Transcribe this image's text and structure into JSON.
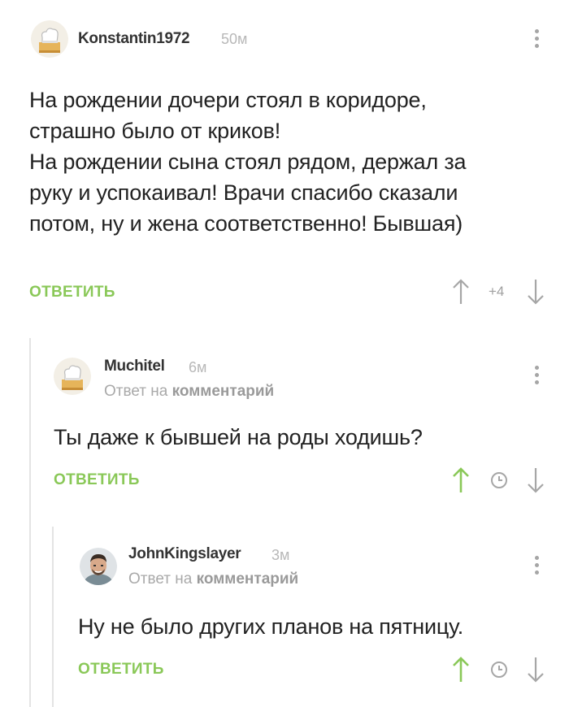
{
  "comments": [
    {
      "username": "Konstantin1972",
      "time": "50м",
      "lines": [
        "На рождении дочери стоял в коридоре,",
        "страшно было от криков!",
        "На рождении сына стоял рядом, держал за",
        "руку и успокаивал! Врачи спасибо сказали",
        "потом, ну и жена соответственно! Бывшая)"
      ],
      "reply_label": "ОТВЕТИТЬ",
      "score": "+4",
      "avatar_icon": "chef-hat-avatar-icon"
    },
    {
      "username": "Muchitel",
      "time": "6м",
      "reply_to_prefix": "Ответ на ",
      "reply_to_link": "комментарий",
      "lines": [
        "Ты даже к бывшей на роды ходишь?"
      ],
      "reply_label": "ОТВЕТИТЬ",
      "avatar_icon": "chef-hat-avatar-icon"
    },
    {
      "username": "JohnKingslayer",
      "time": "3м",
      "reply_to_prefix": "Ответ на ",
      "reply_to_link": "комментарий",
      "lines": [
        "Ну не было других планов на пятницу."
      ],
      "reply_label": "ОТВЕТИТЬ",
      "avatar_icon": "user-photo-avatar"
    }
  ],
  "colors": {
    "accent_green": "#8ac858",
    "vote_gray": "#a6a6a6",
    "thread_line": "#e4e4e4"
  }
}
